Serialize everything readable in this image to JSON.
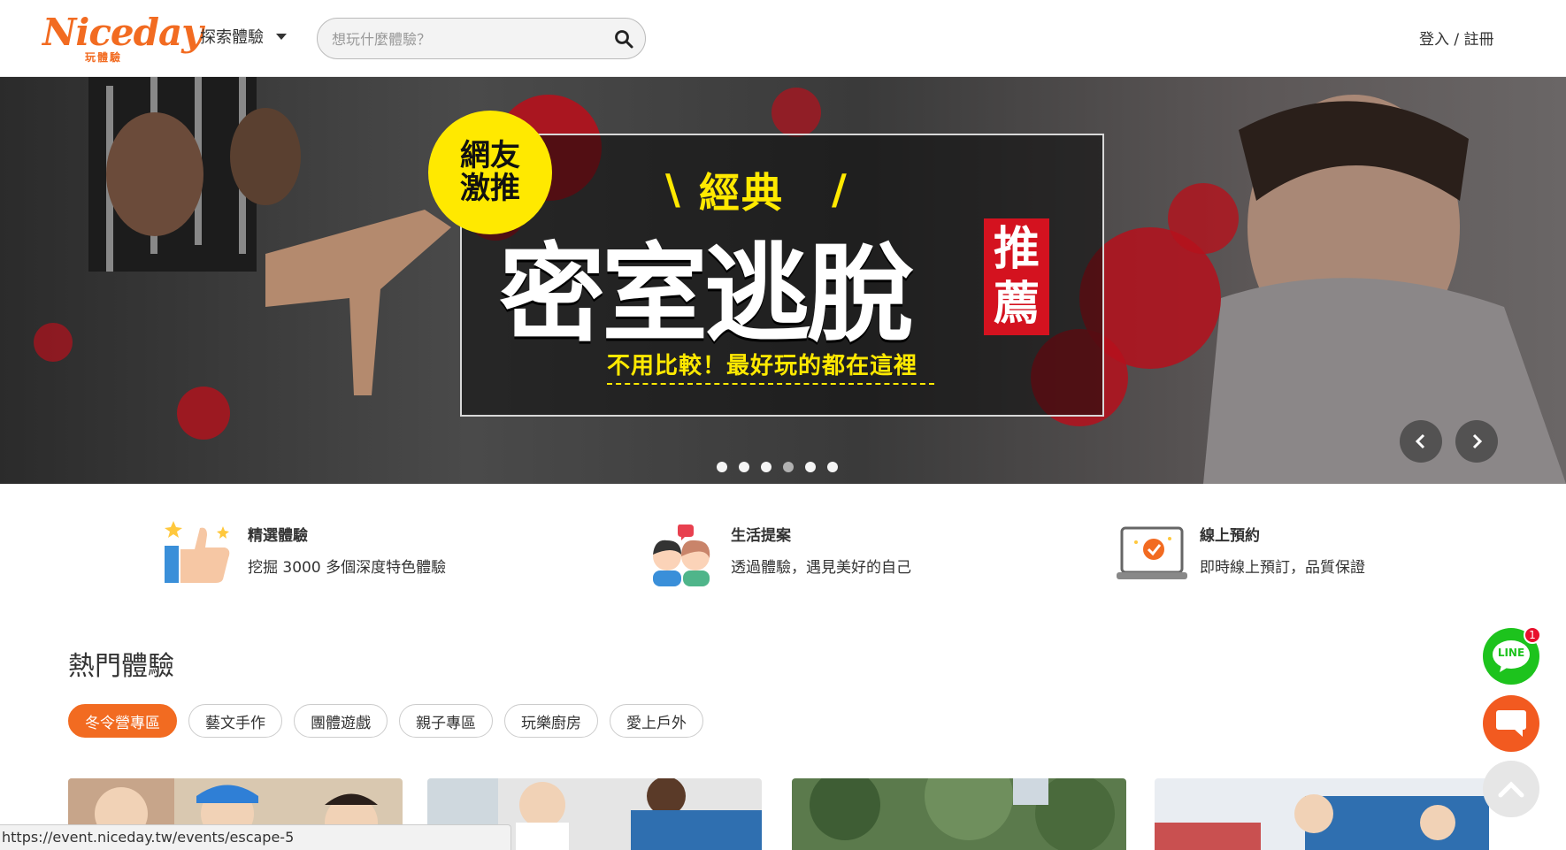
{
  "header": {
    "logo_text": "Niceday",
    "logo_sub": "玩體驗",
    "explore_label": "探索體驗",
    "search_placeholder": "想玩什麼體驗？",
    "login_label": "登入 / 註冊"
  },
  "banner": {
    "badge_line1": "網友",
    "badge_line2": "激推",
    "classic": "經典",
    "headline": "密室逃脫",
    "recommend_line1": "推",
    "recommend_line2": "薦",
    "tagline": "不用比較！最好玩的都在這裡",
    "dot_count": 6,
    "active_dot": 4
  },
  "features": [
    {
      "title": "精選體驗",
      "desc": "挖掘 3000 多個深度特色體驗",
      "icon": "thumbs-up-icon"
    },
    {
      "title": "生活提案",
      "desc": "透過體驗，遇見美好的自己",
      "icon": "couple-icon"
    },
    {
      "title": "線上預約",
      "desc": "即時線上預訂，品質保證",
      "icon": "laptop-check-icon"
    }
  ],
  "hot": {
    "title": "熱門體驗",
    "chips": [
      "冬令營專區",
      "藝文手作",
      "團體遊戲",
      "親子專區",
      "玩樂廚房",
      "愛上戶外"
    ],
    "active_chip": 0
  },
  "floating": {
    "line_label": "LINE",
    "line_badge": "1"
  },
  "status_url": "https://event.niceday.tw/events/escape-5",
  "colors": {
    "brand": "#f26b21",
    "line_green": "#1dc31d",
    "banner_yellow": "#ffe900",
    "banner_red": "#d4121f"
  }
}
